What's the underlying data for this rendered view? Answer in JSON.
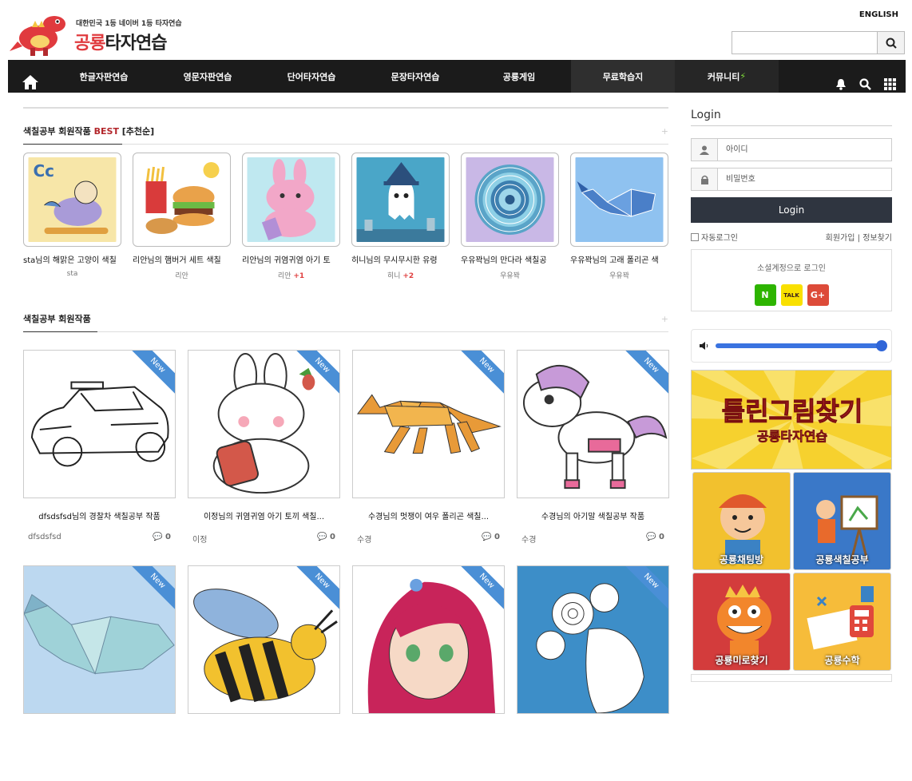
{
  "header": {
    "tagline": "대한민국 1등 네이버 1등 타자연습",
    "brand_red": "공룡",
    "brand_dark": "타자연습",
    "language": "ENGLISH"
  },
  "nav": {
    "items": [
      "한글자판연습",
      "영문자판연습",
      "단어타자연습",
      "문장타자연습",
      "공룡게임",
      "무료학습지",
      "커뮤니티"
    ]
  },
  "best": {
    "title": "색칠공부 회원작품 ",
    "title_hl": "BEST",
    "title_tail": " [추천순]",
    "items": [
      {
        "caption": "sta님의 해맑은 고양이 색칠",
        "author": "sta",
        "plus": ""
      },
      {
        "caption": "리안님의 햄버거 세트 색칠",
        "author": "리안",
        "plus": ""
      },
      {
        "caption": "리안님의 귀염귀염 아기 토",
        "author": "리안",
        "plus": "+1"
      },
      {
        "caption": "히니님의 무시무시한 유령",
        "author": "히니",
        "plus": "+2"
      },
      {
        "caption": "우유꽉님의 만다라 색칠공",
        "author": "우유꽉",
        "plus": ""
      },
      {
        "caption": "우유꽉님의 고래 폴리곤 색",
        "author": "우유꽉",
        "plus": ""
      }
    ]
  },
  "members": {
    "title": "색칠공부 회원작품",
    "ribbon": "New",
    "items": [
      {
        "caption": "dfsdsfsd님의 경찰차 색칠공부 작품",
        "author": "dfsdsfsd",
        "comments": "0"
      },
      {
        "caption": "이정님의 귀염귀염 아기 토끼 색칠...",
        "author": "이정",
        "comments": "0"
      },
      {
        "caption": "수경님의 멋쟁이 여우 폴리곤 색칠...",
        "author": "수경",
        "comments": "0"
      },
      {
        "caption": "수경님의 아기말 색칠공부 작품",
        "author": "수경",
        "comments": "0"
      }
    ]
  },
  "sidebar": {
    "login_title": "Login",
    "id_placeholder": "아이디",
    "pw_placeholder": "비밀번호",
    "login_button": "Login",
    "auto_login": "자동로그인",
    "join": "회원가입",
    "find": "정보찾기",
    "social_title": "소셜계정으로 로그인",
    "social": {
      "naver": "N",
      "kakao": "TALK",
      "google": "G+"
    },
    "banner_line1": "틀린그림찾기",
    "banner_line2": "공룡타자연습",
    "tiles": [
      "공룡채팅방",
      "공룡색칠공부",
      "공룡미로찾기",
      "공룡수학"
    ]
  },
  "colors": {
    "accent": "#b3262b",
    "nav_bg": "#1b1b1b",
    "ribbon": "#4a8fd6",
    "login_btn": "#2f3540"
  }
}
